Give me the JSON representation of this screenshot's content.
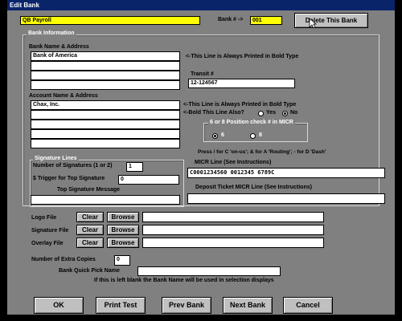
{
  "window": {
    "title": "Edit Bank"
  },
  "top": {
    "payroll_value": "QB Payroll",
    "bank_num_label": "Bank # ->",
    "bank_num_value": "001",
    "delete_button": "Delete This Bank"
  },
  "bank_info": {
    "group_label": "Bank Information",
    "name_addr_label": "Bank Name & Address",
    "bank_lines": [
      "Bank of America",
      "",
      "",
      ""
    ],
    "bold_note1": "<-This Line is Always Printed in Bold Type",
    "transit_label": "Transit #",
    "transit_value": "12-124567",
    "acct_label": "Account Name & Address",
    "acct_lines": [
      "Chax, Inc.",
      "",
      "",
      "",
      "",
      ""
    ],
    "bold_note2": "<-This Line is Always Printed in Bold Type",
    "bold_question": "<-Bold This Line Also?",
    "yes_label": "Yes",
    "no_label": "No",
    "check_label": "6 or 8 Position check # in MICR",
    "opt6": "6",
    "opt8": "8",
    "press_note": "Press / for C  'on-us';  & for  A 'Routing';  - for  D 'Dash'",
    "micr_label": "MICR Line (See Instructions)",
    "micr_value": "C0001234560 0012345 6789C",
    "deposit_label": "Deposit Ticket MICR Line (See Instructions)",
    "deposit_value": ""
  },
  "signature": {
    "group_label": "Signature Lines",
    "num_label": "Number of Signatures (1 or 2)",
    "num_value": "1",
    "trigger_label": "$ Trigger for Top Signature",
    "trigger_value": "0",
    "msg_label": "Top Signature Message",
    "msg_value": ""
  },
  "files": [
    {
      "label": "Logo File",
      "clear": "Clear",
      "browse": "Browse",
      "value": ""
    },
    {
      "label": "Signature File",
      "clear": "Clear",
      "browse": "Browse",
      "value": ""
    },
    {
      "label": "Overlay File",
      "clear": "Clear",
      "browse": "Browse",
      "value": ""
    }
  ],
  "extra": {
    "copies_label": "Number of Extra Copies",
    "copies_value": "0",
    "quickpick_label": "Bank Quick Pick Name",
    "quickpick_value": "",
    "quickpick_note": "If this is left blank the Bank Name will be used in selection displays"
  },
  "buttons": {
    "ok": "OK",
    "print_test": "Print Test",
    "prev_bank": "Prev Bank",
    "next_bank": "Next Bank",
    "cancel": "Cancel"
  },
  "colors": {
    "title_bar": "#0a246a",
    "highlight_field": "#ffff00",
    "window_bg": "#808080"
  }
}
